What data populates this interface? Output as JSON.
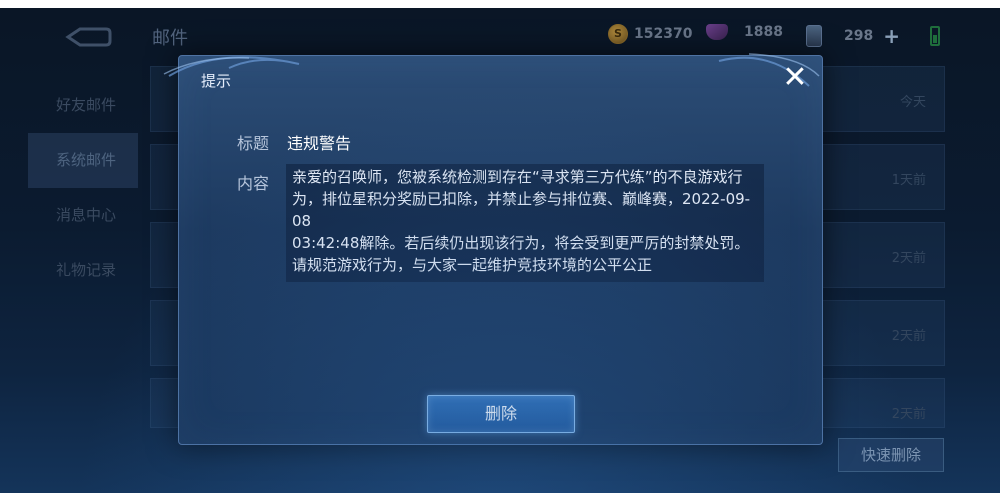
{
  "header": {
    "title": "邮件",
    "gold": "152370",
    "gems": "1888",
    "cards": "298"
  },
  "sidebar": {
    "items": [
      {
        "label": "好友邮件"
      },
      {
        "label": "系统邮件"
      },
      {
        "label": "消息中心"
      },
      {
        "label": "礼物记录"
      }
    ]
  },
  "mail_list": {
    "rows": [
      {
        "time": "今天"
      },
      {
        "time": "1天前"
      },
      {
        "time": "2天前"
      },
      {
        "time": "2天前"
      },
      {
        "time": "2天前"
      }
    ],
    "quick_delete_label": "快速删除"
  },
  "dialog": {
    "title": "提示",
    "subject_label": "标题",
    "subject_value": "违规警告",
    "content_label": "内容",
    "content_value": "亲爱的召唤师，您被系统检测到存在“寻求第三方代练”的不良游戏行为，排位星积分奖励已扣除，并禁止参与排位赛、巅峰赛，2022-09-08\n03:42:48解除。若后续仍出现该行为，将会受到更严厉的封禁处罚。请规范游戏行为，与大家一起维护竞技环境的公平公正",
    "delete_label": "删除"
  }
}
